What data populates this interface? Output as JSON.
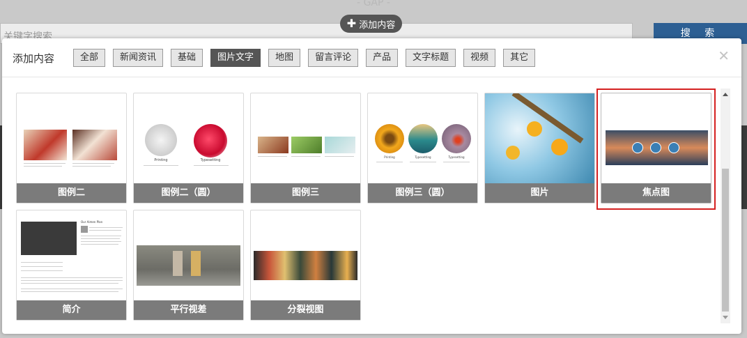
{
  "header": {
    "gap_label": "- GAP -",
    "add_content_label": "添加内容",
    "search_placeholder": "关键字搜索",
    "search_button": "搜 索"
  },
  "modal": {
    "title": "添加内容",
    "tabs": [
      {
        "label": "全部",
        "active": false
      },
      {
        "label": "新闻资讯",
        "active": false
      },
      {
        "label": "基础",
        "active": false
      },
      {
        "label": "图片文字",
        "active": true
      },
      {
        "label": "地图",
        "active": false
      },
      {
        "label": "留言评论",
        "active": false
      },
      {
        "label": "产品",
        "active": false
      },
      {
        "label": "文字标题",
        "active": false
      },
      {
        "label": "视频",
        "active": false
      },
      {
        "label": "其它",
        "active": false
      }
    ],
    "close_icon": "close-icon",
    "cards": [
      {
        "label": "图例二",
        "selected": false
      },
      {
        "label": "图例二（圆）",
        "selected": false
      },
      {
        "label": "图例三",
        "selected": false
      },
      {
        "label": "图例三（圆）",
        "selected": false
      },
      {
        "label": "图片",
        "selected": false
      },
      {
        "label": "焦点图",
        "selected": true
      },
      {
        "label": "简介",
        "selected": false
      },
      {
        "label": "平行视差",
        "selected": false
      },
      {
        "label": "分裂视图",
        "selected": false
      }
    ],
    "thumb_text": {
      "printing": "Printing",
      "typesetting": "Typesetting",
      "about_title": "Our Aimen Plan"
    }
  },
  "colors": {
    "active_tab": "#555555",
    "caption_bg": "#7b7b7b",
    "search_button": "#2d5f93",
    "selection": "#d42020"
  }
}
